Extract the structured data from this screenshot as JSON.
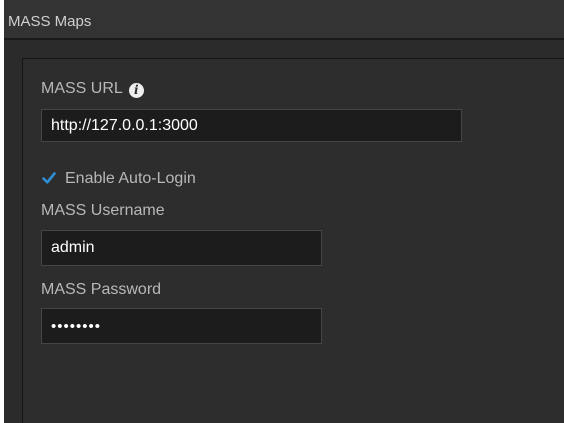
{
  "panel": {
    "title": "MASS Maps"
  },
  "form": {
    "url_label": "MASS URL",
    "url_info_icon": "info-icon",
    "url_value": "http://127.0.0.1:3000",
    "auto_login_label": "Enable Auto-Login",
    "auto_login_checked": true,
    "username_label": "MASS Username",
    "username_value": "admin",
    "password_label": "MASS Password",
    "password_value": "••••••••"
  },
  "colors": {
    "accent": "#2f8fd6",
    "panel_bg": "#2b2b2b",
    "input_bg": "#1c1c1c"
  }
}
